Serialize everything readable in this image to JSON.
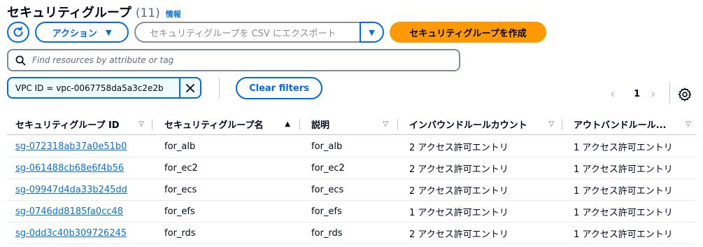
{
  "header": {
    "title": "セキュリティグループ",
    "count": "(11)",
    "info_label": "情報"
  },
  "toolbar": {
    "action_label": "アクション",
    "export_label": "セキュリティグループを CSV にエクスポート",
    "create_label": "セキュリティグループを作成"
  },
  "search": {
    "placeholder": "Find resources by attribute or tag"
  },
  "filter": {
    "token_label": "VPC ID = vpc-0067758da5a3c2e2b",
    "clear_label": "Clear filters"
  },
  "pagination": {
    "current_page": "1"
  },
  "table": {
    "columns": [
      {
        "label": "セキュリティグループ ID",
        "sort": "none"
      },
      {
        "label": "セキュリティグループ名",
        "sort": "ascending"
      },
      {
        "label": "説明",
        "sort": "none"
      },
      {
        "label": "インバウンドルールカウント",
        "sort": "none"
      },
      {
        "label": "アウトバンドルール...",
        "sort": "none"
      }
    ],
    "rows": [
      {
        "id": "sg-072318ab37a0e51b0",
        "name": "for_alb",
        "description": "for_alb",
        "inbound": "2 アクセス許可エントリ",
        "outbound": "1 アクセス許可エントリ"
      },
      {
        "id": "sg-061488cb68e6f4b56",
        "name": "for_ec2",
        "description": "for_ec2",
        "inbound": "2 アクセス許可エントリ",
        "outbound": "1 アクセス許可エントリ"
      },
      {
        "id": "sg-09947d4da33b245dd",
        "name": "for_ecs",
        "description": "for_ecs",
        "inbound": "2 アクセス許可エントリ",
        "outbound": "1 アクセス許可エントリ"
      },
      {
        "id": "sg-0746dd8185fa0cc48",
        "name": "for_efs",
        "description": "for_efs",
        "inbound": "1 アクセス許可エントリ",
        "outbound": "1 アクセス許可エントリ"
      },
      {
        "id": "sg-0dd3c40b309726245",
        "name": "for_rds",
        "description": "for_rds",
        "inbound": "2 アクセス許可エントリ",
        "outbound": "1 アクセス許可エントリ"
      }
    ]
  },
  "colors": {
    "primary": "#006ce0",
    "link": "#0972d3",
    "accent": "#ff9900",
    "text": "#000716",
    "muted": "#5f6b7a"
  },
  "icons": {
    "refresh": "refresh-icon",
    "caret": "caret-down-icon",
    "search": "search-icon",
    "close": "close-icon",
    "prev": "chevron-left-icon",
    "next": "chevron-right-icon",
    "settings": "gear-icon"
  }
}
